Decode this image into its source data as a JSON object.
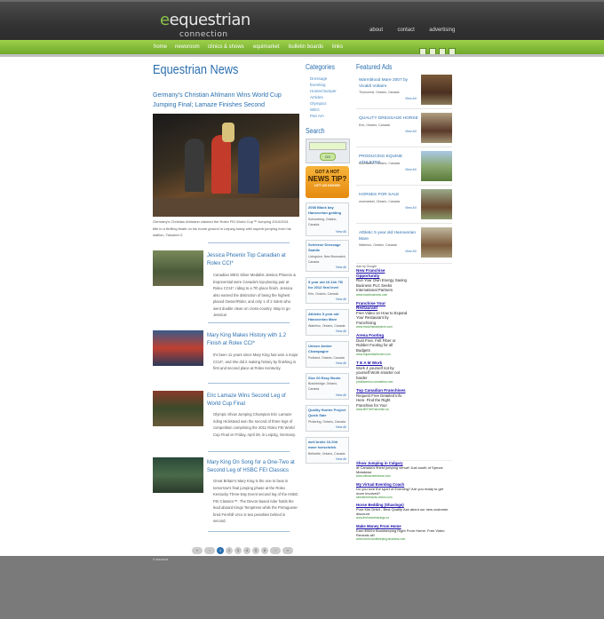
{
  "site": {
    "logo_text": "equestrian",
    "logo_accent": "e",
    "logo_sub": "connection",
    "top_links": [
      "about",
      "contact",
      "advertising"
    ],
    "nav": [
      "home",
      "newsroom",
      "clinics & shows",
      "equimarket",
      "bulletin boards",
      "links"
    ],
    "copyright": "© 2012 ECN"
  },
  "news": {
    "heading": "Equestrian News",
    "featured": {
      "title": "Germany's Christian Ahlmann Wins World Cup Jumping Final; Lamaze Finishes Second",
      "caption": "Germany's Christian Ahlmann claimed the Rolex FEI World Cup™ Jumping 2010/2011 title in a thrilling finale on his home ground in Leipzig today with superb jumping from his stallion, Taloubet Z."
    },
    "stories": [
      {
        "title": "Jessica Phoenix Top Canadian at Rolex CCI*",
        "body": "Canadian WEG Silver Medalist Jessica Phoenix & Exponential were Canada's top-placing pair at Rolex CCI4*, riding to a 7th place finish. Jessica also earned the distinction of being the highest placed Owner/Rider, and only 1 of 2 riders who went double clean on cross-country. Way to go Jessica!"
      },
      {
        "title": "Mary King Makes History with 1,2 Finish at Rolex CCI*",
        "body": "It's been 11 years since Mary King has won a major CCI4*, and she did it making history by finishing in first and second place at Rolex Kentucky."
      },
      {
        "title": "Eric Lamaze Wins Second Leg of World Cup Final",
        "body": "Olympic Show Jumping Champion Eric Lamaze riding Hickstead won the second of three legs of competition comprising the 2011 Rolex FEI World Cup Final on Friday, April 29, in Leipzig, Germany."
      },
      {
        "title": "Mary King On Song for a One-Two at Second Leg of HSBC FEI Classics",
        "body": "Great Britain's Mary King is the one to beat in tomorrow's final jumping phase at the Rolex Kentucky Three-Day Event second leg of the HSBC FEI Classics™. The Devon-based rider holds the lead aboard Kings Temptress while the Portuguese-bred Fernhill Urco is two penalties behind in second."
      }
    ],
    "pager": [
      "«",
      "‹",
      "1",
      "2",
      "3",
      "4",
      "5",
      "6",
      "›",
      "»"
    ]
  },
  "categories": {
    "heading": "Categories",
    "items": [
      "Dressage",
      "Eventing",
      "Hunter/Jumper",
      "Articles",
      "Olympics",
      "WEG",
      "Pan Am"
    ]
  },
  "search": {
    "heading": "Search",
    "button": "GO"
  },
  "news_tip": {
    "line1": "GOT A HOT",
    "line2": "NEWS TIP?",
    "line3": "LET US KNOW!"
  },
  "classifieds": [
    {
      "title": "2008 Black bay Hanoverian gelding",
      "loc": "Schomberg, Ontario, Canada",
      "view": "View All"
    },
    {
      "title": "Schleese Dressage Saddle",
      "loc": "Livingston, New Brunswick, Canada",
      "view": "View All"
    },
    {
      "title": "5 year old 16.1hh TB for 2012 first level",
      "loc": "Erin, Ontario, Canada",
      "view": "View All"
    },
    {
      "title": "Athletic 5 year old Hanoverian Mare",
      "loc": "Waterloo, Ontario, Canada",
      "view": "View All"
    },
    {
      "title": "Unisex Amber Champagne",
      "loc": "Portland, Ontario, Canada",
      "view": "View All"
    },
    {
      "title": "Size 00 Easy Boots",
      "loc": "Brackbridge, Ontario, Canada",
      "view": "View All"
    },
    {
      "title": "Quality Hunter Project Quick Sale",
      "loc": "Pickering, Ontario, Canada",
      "view": "View All"
    },
    {
      "title": "well broke 16.2hh mare horse/wick",
      "loc": "Belleville, Ontario, Canada",
      "view": "View All"
    }
  ],
  "featured_ads": {
    "heading": "Featured Ads",
    "items": [
      {
        "title": "Warmblood Mare 2007 by Vivaldi Voltaire",
        "loc": "Thorncrest, Ontario, Canada",
        "view": "View All"
      },
      {
        "title": "QUALITY DRESSAGE HORSE",
        "loc": "Erin, Ontario, Canada",
        "view": "View All"
      },
      {
        "title": "PRODUCING EQUINE ATHLETES",
        "loc": "newmarket, Ontario, Canada",
        "view": "View All"
      },
      {
        "title": "HORSES FOR SALE",
        "loc": "newmarket, Ontario, Canada",
        "view": "View All"
      },
      {
        "title": "Athletic 5 year old Hanoverian Mare",
        "loc": "Waterloo, Ontario, Canada",
        "view": "View All"
      }
    ]
  },
  "google_ads": {
    "label": "Ads by Google",
    "items": [
      {
        "title": "New Franchise Opportunity",
        "body": "Run Your Own Energy Saving Business PLC Seeks International Partners",
        "url": "www.bookbusiness.com"
      },
      {
        "title": "Franchise Your Restaurant",
        "body": "Free Video on How to Expand Your Restaurant by Franchising",
        "url": "www.franchiseadvance.com"
      },
      {
        "title": "Arena Footing",
        "body": "Dust Free. Felt Fiber or Rubber Footing for all Budgets",
        "url": "www.equestrianfooter.com"
      },
      {
        "title": "T E A M Work",
        "body": "Work 4 yourself not by yourself Work smarter not harder",
        "url": "prioflawnfour.cosmetics.com"
      },
      {
        "title": "Top Canadian Franchises",
        "body": "Request Free Detailed Info Here. Find the Right Franchise for You!",
        "url": "www.BeTheFranchise.ca"
      }
    ],
    "items2": [
      {
        "title": "Show Jumping in Calgary",
        "body": "at Canada's finest jumping venue! Just south of Spruce Meadows",
        "url": "www.willowcreekhorse.com"
      },
      {
        "title": "My Virtual Eventing Coach",
        "body": "Do you love the sport of Eventing? Are you ready to get more involved?",
        "url": "stressfreeresults.vecfun.com"
      },
      {
        "title": "Horse Bedding (Shavings)",
        "body": "Pure Kiln Dried - Best Quality Ask about our new customer discount",
        "url": "www.thehorseshavings.ca"
      },
      {
        "title": "Make Money From Home",
        "body": "Earn $90/hr Bookkeeping Right From Home. Free Video Reveals all!",
        "url": "www.home-bookkeeping-business.com"
      }
    ]
  }
}
